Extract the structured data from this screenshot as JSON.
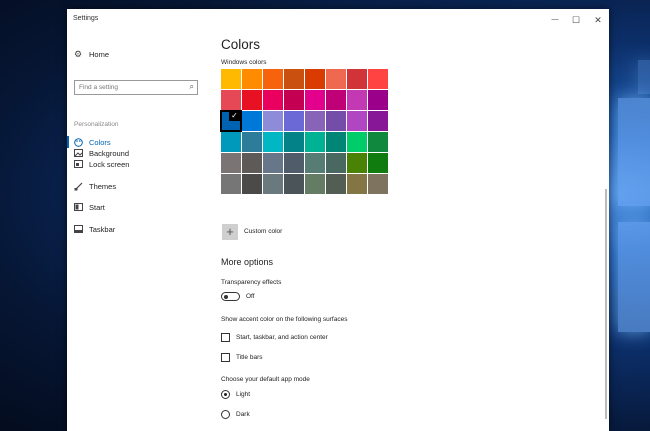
{
  "window": {
    "title": "Settings",
    "controls": {
      "minimize": "—",
      "maximize": "☐",
      "close": "✕"
    }
  },
  "sidebar": {
    "home": "Home",
    "search_placeholder": "Find a setting",
    "section": "Personalization",
    "items": [
      {
        "label": "Background",
        "icon": "picture-icon"
      },
      {
        "label": "Colors",
        "icon": "palette-icon",
        "active": true
      },
      {
        "label": "Lock screen",
        "icon": "lock-screen-icon"
      },
      {
        "label": "Themes",
        "icon": "brush-icon"
      },
      {
        "label": "Start",
        "icon": "start-menu-icon"
      },
      {
        "label": "Taskbar",
        "icon": "taskbar-icon"
      }
    ]
  },
  "main": {
    "title": "Colors",
    "windows_colors_label": "Windows colors",
    "swatches": [
      "#ffb900",
      "#ff8c00",
      "#f7630c",
      "#ca5010",
      "#da3b01",
      "#ef6950",
      "#d13438",
      "#ff4343",
      "#e74856",
      "#e81123",
      "#ea005e",
      "#c30052",
      "#e3008c",
      "#bf0077",
      "#c239b3",
      "#9a0089",
      "#0063b1",
      "#0078d7",
      "#8e8cd8",
      "#6b69d6",
      "#8764b8",
      "#744da9",
      "#b146c2",
      "#881798",
      "#0099bc",
      "#2d7d9a",
      "#00b7c3",
      "#038387",
      "#00b294",
      "#018574",
      "#00cc6a",
      "#10893e",
      "#7a7574",
      "#5d5a58",
      "#68768a",
      "#515c6b",
      "#567c73",
      "#486860",
      "#498205",
      "#107c10",
      "#767676",
      "#4c4a48",
      "#69797e",
      "#4a5459",
      "#647c64",
      "#525e54",
      "#847545",
      "#7e735f"
    ],
    "selected_swatch_index": 16,
    "custom_color_label": "Custom color",
    "more_options_title": "More options",
    "transparency_label": "Transparency effects",
    "transparency_state": "Off",
    "accent_surfaces_label": "Show accent color on the following surfaces",
    "surface_options": [
      "Start, taskbar, and action center",
      "Title bars"
    ],
    "app_mode_label": "Choose your default app mode",
    "app_modes": [
      "Light",
      "Dark"
    ],
    "selected_app_mode": "Light"
  }
}
